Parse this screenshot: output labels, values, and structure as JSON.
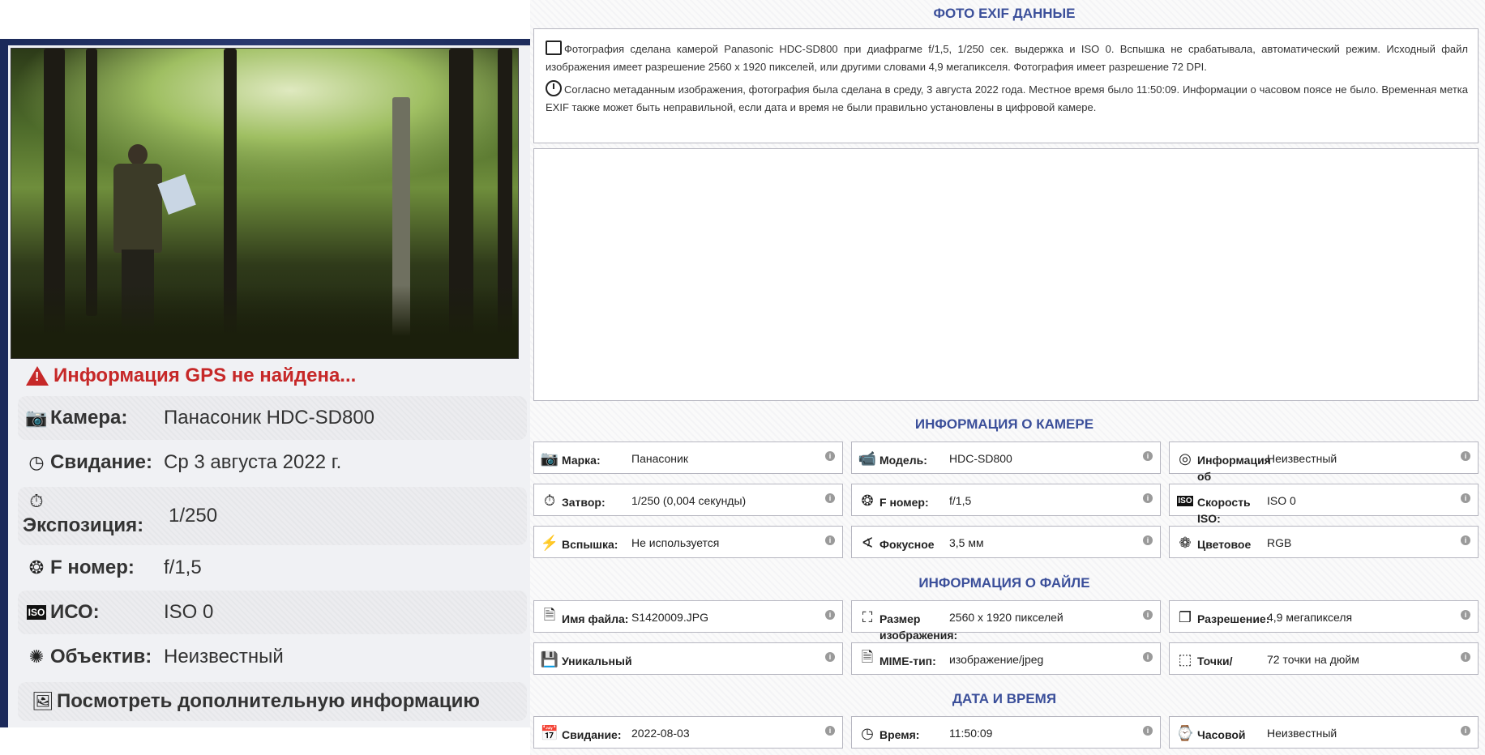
{
  "left": {
    "gps_warning": "Информация GPS не найдена...",
    "rows": [
      {
        "icon": "camera-icon",
        "label": "Камера:",
        "value": "Панасоник HDC-SD800"
      },
      {
        "icon": "clock-icon",
        "label": "Свидание:",
        "value": "Ср 3 августа 2022 г."
      },
      {
        "icon": "timer-icon",
        "label": "Экспозиция:",
        "value": "1/250"
      },
      {
        "icon": "aperture-icon",
        "label": "F номер:",
        "value": "f/1,5"
      },
      {
        "icon": "iso-icon",
        "label": "ИСО:",
        "value": "ISO 0"
      },
      {
        "icon": "lens-icon",
        "label": "Объектив:",
        "value": "Неизвестный"
      }
    ],
    "more_info": "Посмотреть дополнительную информацию"
  },
  "right": {
    "exif_title": "ФОТО EXIF ДАННЫЕ",
    "exif_summary": "Фотография сделана камерой Panasonic HDC-SD800 при диафрагме f/1,5, 1/250 сек. выдержка и ISO 0. Вспышка не срабатывала, автоматический режим. Исходный файл изображения имеет разрешение 2560 x 1920 пикселей, или другими словами 4,9 мегапикселя. Фотография имеет разрешение 72 DPI.",
    "exif_time": "Согласно метаданным изображения, фотография была сделана в среду, 3 августа 2022 года. Местное время было 11:50:09. Информации о часовом поясе не было. Временная метка EXIF также может быть неправильной, если дата и время не были правильно установлены в цифровой камере.",
    "camera_title": "ИНФОРМАЦИЯ О КАМЕРЕ",
    "camera": [
      {
        "icon": "camera-icon",
        "label": "Марка:",
        "value": "Панасоник"
      },
      {
        "icon": "camera-body-icon",
        "label": "Модель:",
        "value": "HDC-SD800"
      },
      {
        "icon": "lens-info-icon",
        "label": "Информация об",
        "value": "Неизвестный"
      },
      {
        "icon": "shutter-icon",
        "label": "Затвор:",
        "value": "1/250 (0,004 секунды)"
      },
      {
        "icon": "aperture-icon",
        "label": "F номер:",
        "value": "f/1,5"
      },
      {
        "icon": "iso-icon",
        "label": "Скорость ISO:",
        "value": "ISO 0"
      },
      {
        "icon": "flash-icon",
        "label": "Вспышка:",
        "value": "Не используется"
      },
      {
        "icon": "focal-icon",
        "label": "Фокусное",
        "value": "3,5 мм"
      },
      {
        "icon": "color-icon",
        "label": "Цветовое",
        "value": "RGB"
      }
    ],
    "file_title": "ИНФОРМАЦИЯ О ФАЙЛЕ",
    "file": [
      {
        "icon": "jpg-file-icon",
        "label": "Имя файла:",
        "value": "S1420009.JPG"
      },
      {
        "icon": "image-size-icon",
        "label": "Размер изображения:",
        "value": "2560 x 1920 пикселей"
      },
      {
        "icon": "resolution-icon",
        "label": "Разрешение:",
        "value": "4,9 мегапикселя"
      },
      {
        "icon": "save-icon",
        "label": "Уникальный",
        "value": ""
      },
      {
        "icon": "jpg-mime-icon",
        "label": "MIME-тип:",
        "value": "изображение/jpeg"
      },
      {
        "icon": "dpi-icon",
        "label": "Точки/",
        "value": "72 точки на дюйм"
      }
    ],
    "datetime_title": "ДАТА И ВРЕМЯ",
    "datetime": [
      {
        "icon": "calendar-icon",
        "label": "Свидание:",
        "value": "2022-08-03"
      },
      {
        "icon": "clock-icon",
        "label": "Время:",
        "value": "11:50:09"
      },
      {
        "icon": "timezone-icon",
        "label": "Часовой",
        "value": "Неизвестный"
      }
    ]
  }
}
